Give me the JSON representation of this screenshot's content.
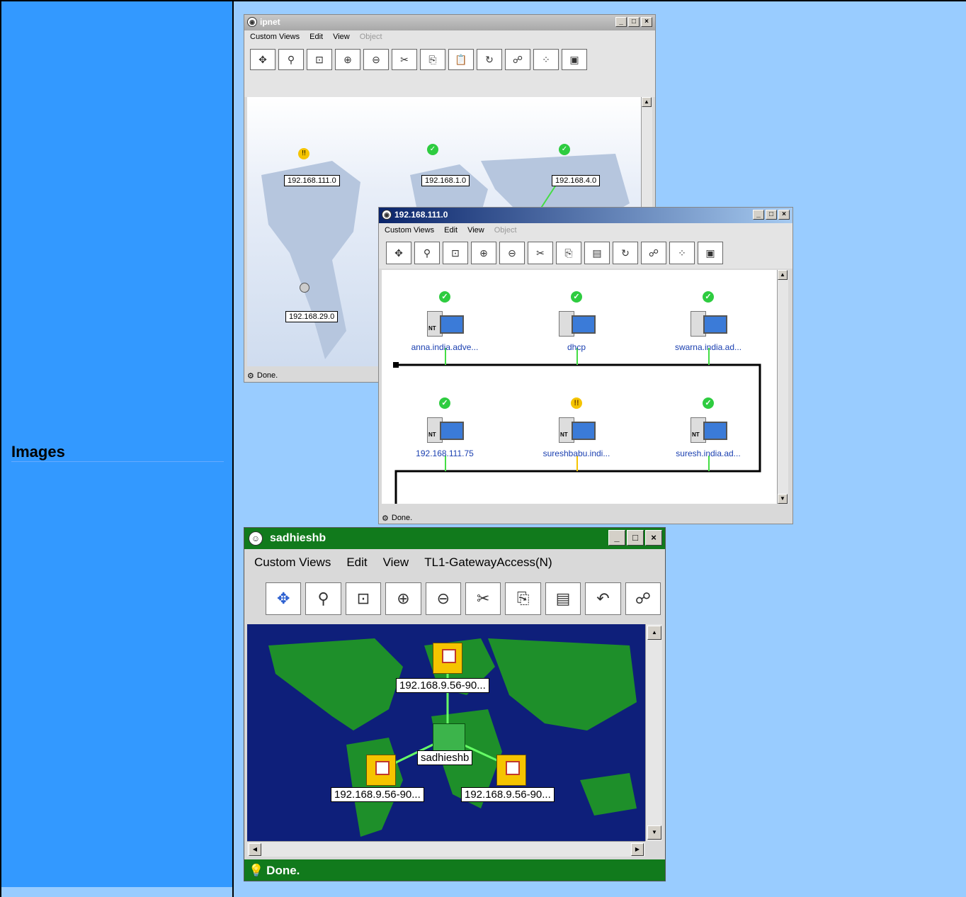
{
  "row": {
    "label": "Images"
  },
  "ipnet_window": {
    "title": "ipnet",
    "menu": [
      "Custom Views",
      "Edit",
      "View",
      "Object"
    ],
    "networks": [
      "192.168.111.0",
      "192.168.1.0",
      "192.168.4.0",
      "192.168.29.0"
    ],
    "status": "Done."
  },
  "subnet_window": {
    "title": "192.168.111.0",
    "menu": [
      "Custom Views",
      "Edit",
      "View",
      "Object"
    ],
    "nodes": [
      {
        "label": "anna.india.adve...",
        "status": "ok"
      },
      {
        "label": "dhcp",
        "status": "ok"
      },
      {
        "label": "swarna.india.ad...",
        "status": "ok"
      },
      {
        "label": "192.168.111.75",
        "status": "ok"
      },
      {
        "label": "sureshbabu.indi...",
        "status": "warning"
      },
      {
        "label": "suresh.india.ad...",
        "status": "ok"
      }
    ],
    "status": "Done."
  },
  "sadhieshb_window": {
    "title": "sadhieshb",
    "menu": [
      "Custom Views",
      "Edit",
      "View",
      "TL1-GatewayAccess(N)"
    ],
    "devices": [
      "192.168.9.56-90...",
      "sadhieshb",
      "192.168.9.56-90...",
      "192.168.9.56-90..."
    ],
    "status": "Done."
  },
  "colors": {
    "page_bg": "#99ccff",
    "label_col": "#3399ff",
    "title_green": "#117a1c",
    "map_sea": "#0e1f7a",
    "map_land": "#1e8f2a"
  },
  "icons": [
    "minimize-icon",
    "maximize-icon",
    "close-icon",
    "check-icon",
    "warning-icon"
  ]
}
